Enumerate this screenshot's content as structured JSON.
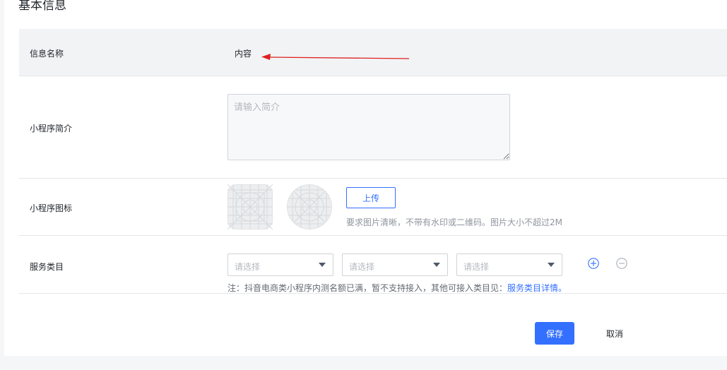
{
  "section": {
    "title": "基本信息"
  },
  "info_name": {
    "label": "信息名称",
    "value": "内容"
  },
  "intro": {
    "label": "小程序简介",
    "placeholder": "请输入简介"
  },
  "icon": {
    "label": "小程序图标",
    "upload_label": "上传",
    "hint": "要求图片清晰，不带有水印或二维码。图片大小不超过2M"
  },
  "service": {
    "label": "服务类目",
    "selects": [
      {
        "placeholder": "请选择"
      },
      {
        "placeholder": "请选择"
      },
      {
        "placeholder": "请选择"
      }
    ],
    "note_text": "注：抖音电商类小程序内测名额已满，暂不支持接入，其他可接入类目见：",
    "note_link": "服务类目详情。"
  },
  "actions": {
    "save_label": "保存",
    "cancel_label": "取消"
  },
  "colors": {
    "accent": "#3370ff",
    "arrow": "#e02020"
  }
}
